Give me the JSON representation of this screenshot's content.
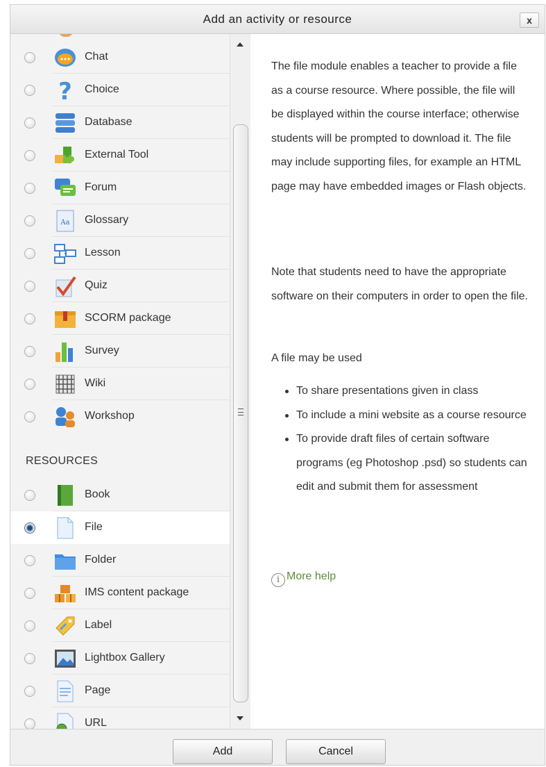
{
  "dialog": {
    "title": "Add an activity or resource",
    "close_label": "x"
  },
  "activities": [
    {
      "label": "Chat",
      "icon": "chat-icon",
      "selected": false
    },
    {
      "label": "Choice",
      "icon": "choice-icon",
      "selected": false
    },
    {
      "label": "Database",
      "icon": "database-icon",
      "selected": false
    },
    {
      "label": "External Tool",
      "icon": "external-tool-icon",
      "selected": false
    },
    {
      "label": "Forum",
      "icon": "forum-icon",
      "selected": false
    },
    {
      "label": "Glossary",
      "icon": "glossary-icon",
      "selected": false
    },
    {
      "label": "Lesson",
      "icon": "lesson-icon",
      "selected": false
    },
    {
      "label": "Quiz",
      "icon": "quiz-icon",
      "selected": false
    },
    {
      "label": "SCORM package",
      "icon": "scorm-package-icon",
      "selected": false
    },
    {
      "label": "Survey",
      "icon": "survey-icon",
      "selected": false
    },
    {
      "label": "Wiki",
      "icon": "wiki-icon",
      "selected": false
    },
    {
      "label": "Workshop",
      "icon": "workshop-icon",
      "selected": false
    }
  ],
  "resources_header": "RESOURCES",
  "resources": [
    {
      "label": "Book",
      "icon": "book-icon",
      "selected": false
    },
    {
      "label": "File",
      "icon": "file-icon",
      "selected": true
    },
    {
      "label": "Folder",
      "icon": "folder-icon",
      "selected": false
    },
    {
      "label": "IMS content package",
      "icon": "ims-content-package-icon",
      "selected": false
    },
    {
      "label": "Label",
      "icon": "label-icon",
      "selected": false
    },
    {
      "label": "Lightbox Gallery",
      "icon": "lightbox-gallery-icon",
      "selected": false
    },
    {
      "label": "Page",
      "icon": "page-icon",
      "selected": false
    },
    {
      "label": "URL",
      "icon": "url-icon",
      "selected": false
    }
  ],
  "help": {
    "paragraph1": "The file module enables a teacher to provide a file as a course resource. Where possible, the file will be displayed within the course interface; otherwise students will be prompted to download it. The file may include supporting files, for example an HTML page may have embedded images or Flash objects.",
    "paragraph2": "Note that students need to have the appropriate software on their computers in order to open the file.",
    "paragraph3": "A file may be used",
    "bullets": [
      "To share presentations given in class",
      "To include a mini website as a course resource",
      "To provide draft files of certain software programs (eg Photoshop .psd) so students can edit and submit them for assessment"
    ],
    "more_help_label": "More help",
    "info_glyph": "i"
  },
  "footer": {
    "add_label": "Add",
    "cancel_label": "Cancel"
  },
  "colors": {
    "link_green": "#5f8d3a",
    "selected_radio": "#1f4a7a"
  }
}
